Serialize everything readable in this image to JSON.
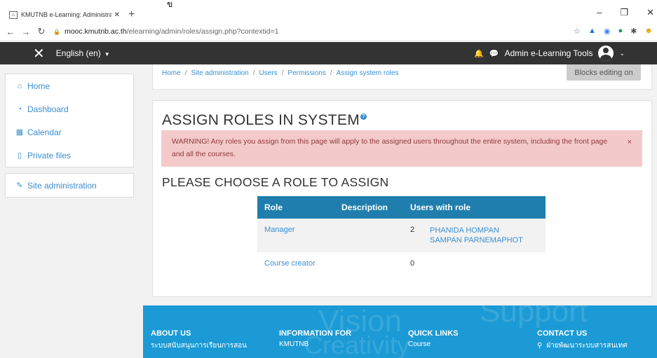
{
  "stray_char": "ข",
  "browser": {
    "tab_title": "KMUTNB e-Learning: Administra",
    "new_tab": "+",
    "window_controls": [
      "–",
      "❐",
      "✕"
    ],
    "url_host": "mooc.kmutnb.ac.th",
    "url_path": "/elearning/admin/roles/assign.php?contextid=1"
  },
  "navbar": {
    "language": "English (en)",
    "user_name": "Admin e-Learning Tools"
  },
  "drawer": {
    "items": [
      {
        "label": "Home",
        "icon": "home-icon"
      },
      {
        "label": "Dashboard",
        "icon": "dashboard-icon"
      },
      {
        "label": "Calendar",
        "icon": "calendar-icon"
      },
      {
        "label": "Private files",
        "icon": "file-icon"
      }
    ],
    "admin_item": {
      "label": "Site administration",
      "icon": "wrench-icon"
    }
  },
  "breadcrumb": [
    "Home",
    "Site administration",
    "Users",
    "Permissions",
    "Assign system roles"
  ],
  "blocks_button": "Blocks editing on",
  "main": {
    "heading": "ASSIGN ROLES IN SYSTEM",
    "alert": "WARNING! Any roles you assign from this page will apply to the assigned users throughout the entire system, including the front page and all the courses.",
    "alert_close": "×",
    "subheading": "PLEASE CHOOSE A ROLE TO ASSIGN",
    "table": {
      "headers": [
        "Role",
        "Description",
        "Users with role"
      ],
      "rows": [
        {
          "role": "Manager",
          "description": "",
          "count": "2",
          "users": [
            "PHANIDA HOMPAN",
            "SAMPAN PARNEMAPHOT"
          ]
        },
        {
          "role": "Course creator",
          "description": "",
          "count": "0",
          "users": []
        }
      ]
    }
  },
  "footer": {
    "columns": [
      {
        "heading": "ABOUT US",
        "item": "ระบบสนับสนุนการเรียนการสอน"
      },
      {
        "heading": "INFORMATION FOR",
        "item": "KMUTNB"
      },
      {
        "heading": "QUICK LINKS",
        "item": "Course"
      },
      {
        "heading": "CONTACT US",
        "item": "ฝ่ายพัฒนาระบบสารสนเทศ"
      }
    ],
    "watermarks": [
      "Vision",
      "Support",
      "Creativity"
    ]
  },
  "colors": {
    "navbar_bg": "#333333",
    "link": "#3a8fd1",
    "table_header": "#1f7ead",
    "alert_bg": "#f4c9ca",
    "footer_bg": "#1b9ad5"
  }
}
